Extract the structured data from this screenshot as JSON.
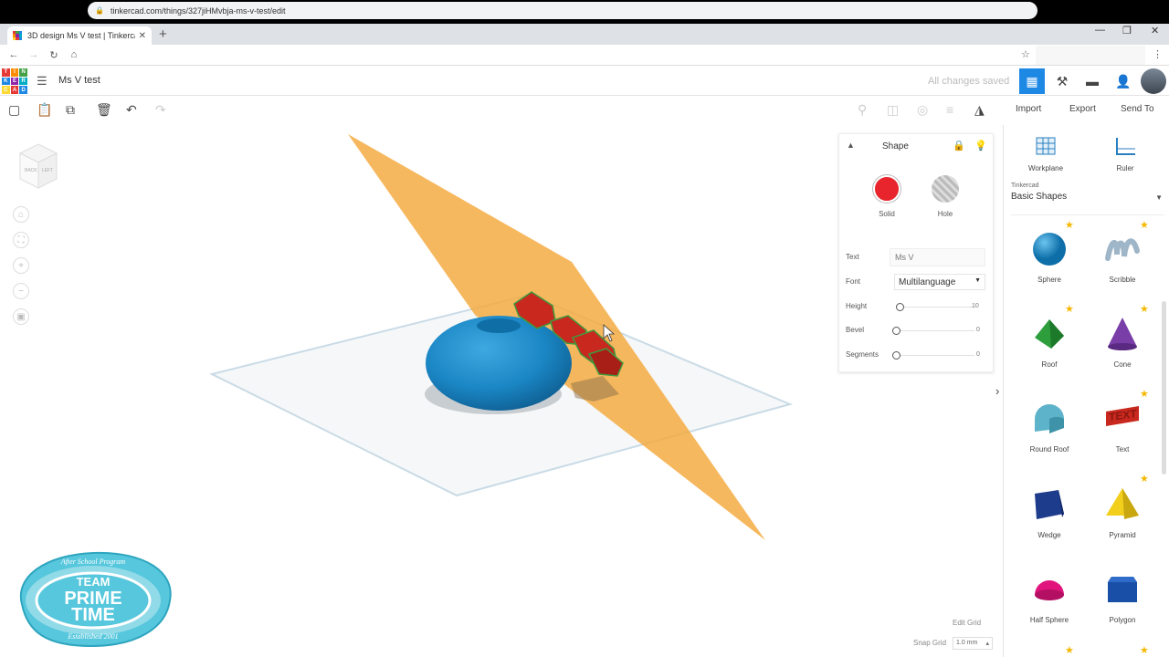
{
  "browser": {
    "tab_title": "3D design Ms V test | Tinkercad",
    "url": "tinkercad.com/things/327jiHMvbja-ms-v-test/edit"
  },
  "app": {
    "logo_letters": [
      "T",
      "I",
      "N",
      "K",
      "E",
      "R",
      "C",
      "A",
      "D"
    ],
    "design_name": "Ms V test",
    "save_status": "All changes saved"
  },
  "toolbar": {
    "import_label": "Import",
    "export_label": "Export",
    "sendto_label": "Send To"
  },
  "viewcube": {
    "back_label": "BACK",
    "left_label": "LEFT"
  },
  "inspector": {
    "title": "Shape",
    "solid_label": "Solid",
    "hole_label": "Hole",
    "solid_color": "#e8242c",
    "text_label": "Text",
    "text_value": "Ms V",
    "font_label": "Font",
    "font_value": "Multilanguage",
    "height_label": "Height",
    "height_value": "10",
    "bevel_label": "Bevel",
    "bevel_value": "0",
    "segments_label": "Segments",
    "segments_value": "0"
  },
  "library": {
    "workplane_label": "Workplane",
    "ruler_label": "Ruler",
    "category_small": "Tinkercad",
    "category_value": "Basic Shapes",
    "shapes": [
      {
        "name": "Sphere",
        "icon": "sphere-icon"
      },
      {
        "name": "Scribble",
        "icon": "scribble-icon"
      },
      {
        "name": "Roof",
        "icon": "roof-icon"
      },
      {
        "name": "Cone",
        "icon": "cone-icon"
      },
      {
        "name": "Round Roof",
        "icon": "round-roof-icon"
      },
      {
        "name": "Text",
        "icon": "text-shape-icon"
      },
      {
        "name": "Wedge",
        "icon": "wedge-icon"
      },
      {
        "name": "Pyramid",
        "icon": "pyramid-icon"
      },
      {
        "name": "Half Sphere",
        "icon": "half-sphere-icon"
      },
      {
        "name": "Polygon",
        "icon": "polygon-icon"
      }
    ]
  },
  "grid": {
    "edit_grid_label": "Edit Grid",
    "snap_grid_label": "Snap Grid",
    "snap_grid_value": "1.0 mm"
  },
  "watermark": {
    "team": "TEAM",
    "prime": "PRIME",
    "time": "TIME",
    "top_arc": "After School Program",
    "bottom_arc": "Established 2001"
  },
  "colors": {
    "accent": "#1e88e5",
    "workplane_orange": "#f4a83a",
    "shape_blue": "#1a86c4",
    "text_red": "#c8281e"
  }
}
